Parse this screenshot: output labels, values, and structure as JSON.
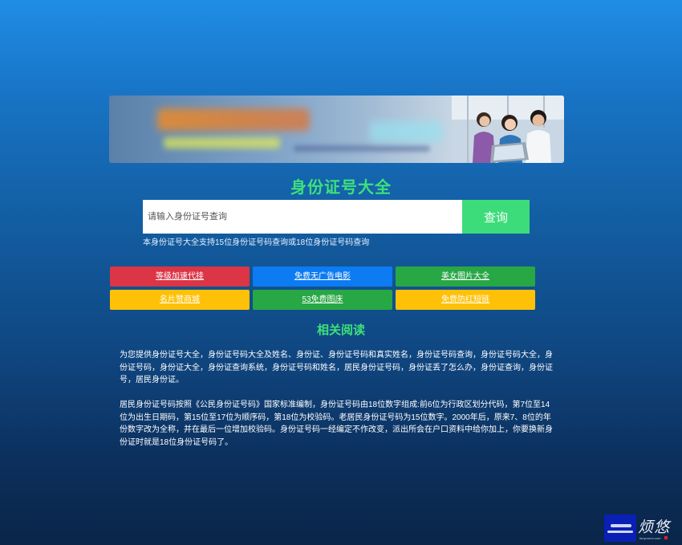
{
  "banner": {
    "label": "advertisement-banner"
  },
  "title": "身份证号大全",
  "search": {
    "placeholder": "请输入身份证号查询",
    "button": "查询",
    "hint": "本身份证号大全支持15位身份证号码查询或18位身份证号码查询"
  },
  "links": [
    {
      "label": "等级加速代挂",
      "color": "#dc3545"
    },
    {
      "label": "免费无广告电影",
      "color": "#0d7bf2"
    },
    {
      "label": "美女图片大全",
      "color": "#28a745"
    },
    {
      "label": "名片赞商城",
      "color": "#ffc107"
    },
    {
      "label": "53免费图床",
      "color": "#28a745"
    },
    {
      "label": "免费防红短链",
      "color": "#ffc107"
    }
  ],
  "related": {
    "title": "相关阅读",
    "paragraphs": [
      "为您提供身份证号大全，身份证号码大全及姓名、身份证、身份证号码和真实姓名，身份证号码查询，身份证号码大全，身份证号码，身份证大全，身份证查询系统，身份证号码和姓名，居民身份证号码，身份证丢了怎么办，身份证查询，身份证号，居民身份证。",
      "居民身份证号码按照《公民身份证号码》国家标准编制，身份证号码由18位数字组成:前6位为行政区划分代码，第7位至14位为出生日期码，第15位至17位为顺序码，第18位为校验码。老居民身份证号码为15位数字。2000年后，原来7、8位的年份数字改为全称，并在最后一位增加校验码。身份证号码一经编定不作改变，派出所会在户口资料中给你加上，你要换新身份证时就是18位身份证号码了。"
    ]
  },
  "logo": {
    "script": "烦悠",
    "caption": "fanyouren.com"
  }
}
